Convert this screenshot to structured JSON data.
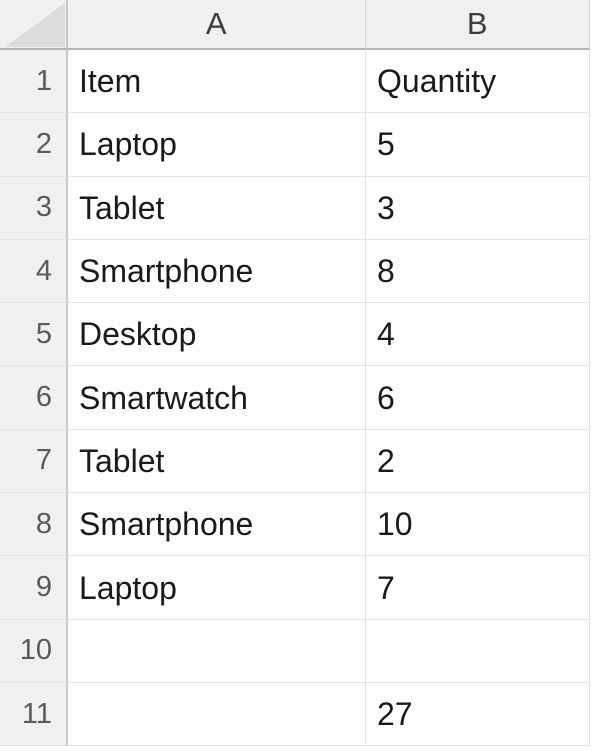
{
  "app": {
    "type": "spreadsheet",
    "corner_icon": "select-all-corner-icon"
  },
  "grid": {
    "column_headers": [
      "A",
      "B"
    ],
    "row_headers": [
      "1",
      "2",
      "3",
      "4",
      "5",
      "6",
      "7",
      "8",
      "9",
      "10",
      "11"
    ],
    "columns": [
      {
        "letter": "A",
        "field": "item"
      },
      {
        "letter": "B",
        "field": "quantity"
      }
    ],
    "rows": [
      {
        "number": "1",
        "a": "Item",
        "b": "Quantity"
      },
      {
        "number": "2",
        "a": "Laptop",
        "b": "5"
      },
      {
        "number": "3",
        "a": "Tablet",
        "b": "3"
      },
      {
        "number": "4",
        "a": "Smartphone",
        "b": "8"
      },
      {
        "number": "5",
        "a": "Desktop",
        "b": "4"
      },
      {
        "number": "6",
        "a": "Smartwatch",
        "b": "6"
      },
      {
        "number": "7",
        "a": "Tablet",
        "b": "2"
      },
      {
        "number": "8",
        "a": "Smartphone",
        "b": "10"
      },
      {
        "number": "9",
        "a": "Laptop",
        "b": "7"
      },
      {
        "number": "10",
        "a": "",
        "b": ""
      },
      {
        "number": "11",
        "a": "",
        "b": "27"
      }
    ]
  },
  "chart_data": {
    "type": "table",
    "title": "",
    "columns": [
      "Item",
      "Quantity"
    ],
    "rows": [
      [
        "Laptop",
        5
      ],
      [
        "Tablet",
        3
      ],
      [
        "Smartphone",
        8
      ],
      [
        "Desktop",
        4
      ],
      [
        "Smartwatch",
        6
      ],
      [
        "Tablet",
        2
      ],
      [
        "Smartphone",
        10
      ],
      [
        "Laptop",
        7
      ]
    ],
    "total_row": [
      "",
      27
    ],
    "total_value": 27
  },
  "colors": {
    "header_background": "#f0f0f0",
    "cell_background": "#fdfdfd",
    "gridline": "#e0e0e0",
    "header_text": "#3c3c3c",
    "row_number_text": "#5a5a5a",
    "cell_text": "#1a1a1a",
    "corner_triangle": "#dcdcdc"
  }
}
